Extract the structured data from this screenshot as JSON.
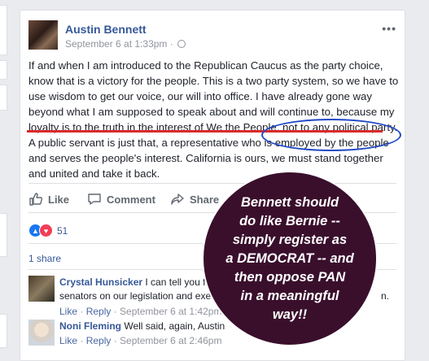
{
  "post": {
    "author": "Austin Bennett",
    "timestamp": "September 6 at 1:33pm ·",
    "more": "•••",
    "body_lines": [
      "If and when I am introduced to the Republican Caucus as the party choice,",
      "know that is a victory for the people. This is a two party system, so we have to",
      "use wisdom to get our voice, our will into office. I have already gone way",
      "beyond what I am supposed to speak about and will continue to, because my",
      "loyalty is to the truth in the interest of We the People, not to any political party.",
      "A public servant is just that, a representative who is employed by the people",
      "and serves the people's interest. California is ours, we must stand together",
      "and united and take it back."
    ]
  },
  "actions": {
    "like": "Like",
    "comment": "Comment",
    "share": "Share"
  },
  "reactions": {
    "count": "51"
  },
  "shares": "1 share",
  "comments": [
    {
      "name": "Crystal Hunsicker",
      "text_line1": "I can tell you from",
      "text_line1_tail": "n.",
      "text_line2": "senators on our legislation and exempt",
      "like": "Like",
      "reply": "Reply",
      "time": "September 6 at 1:42pm"
    },
    {
      "name": "Noni Fleming",
      "text_line1": "Well said, again, Austin",
      "like": "Like",
      "reply": "Reply",
      "time": "September 6 at 2:46pm"
    }
  ],
  "overlay": {
    "lines": [
      "Bennett should",
      "do like Bernie --",
      "simply register as",
      "a DEMOCRAT -- and",
      "then oppose PAN",
      "in a meaningful",
      "way!!"
    ]
  },
  "colors": {
    "link": "#365899",
    "underline": "#d92b2b",
    "ellipse": "#1f47c7",
    "bubble": "#3a0f2c"
  }
}
